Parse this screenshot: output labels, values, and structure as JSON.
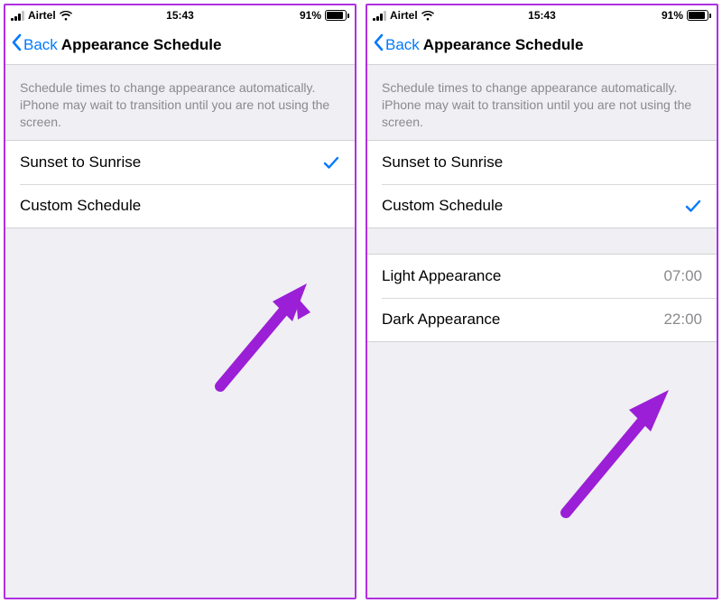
{
  "status": {
    "carrier": "Airtel",
    "time": "15:43",
    "battery_pct": "91%",
    "battery_fill_pct": 91
  },
  "nav": {
    "back": "Back",
    "title": "Appearance Schedule"
  },
  "description": "Schedule times to change appearance automatically. iPhone may wait to transition until you are not using the screen.",
  "options": {
    "sunset_sunrise": "Sunset to Sunrise",
    "custom": "Custom Schedule"
  },
  "times": {
    "light_label": "Light Appearance",
    "light_value": "07:00",
    "dark_label": "Dark Appearance",
    "dark_value": "22:00"
  }
}
